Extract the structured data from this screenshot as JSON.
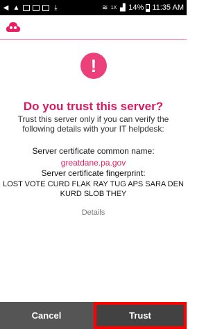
{
  "status_bar": {
    "signal_label": "1X",
    "battery": "14%",
    "time": "11:35 AM"
  },
  "dialog": {
    "warning_symbol": "!",
    "title": "Do you trust this server?",
    "description": "Trust this server only if you can verify the following details with your IT helpdesk:",
    "common_name_label": "Server certificate common name:",
    "common_name_value": "greatdane.pa.gov",
    "fingerprint_label": "Server certificate fingerprint:",
    "fingerprint_value": "LOST VOTE CURD FLAK RAY TUG APS SARA DEN KURD SLOB THEY",
    "details_link": "Details"
  },
  "actions": {
    "cancel_label": "Cancel",
    "trust_label": "Trust"
  },
  "colors": {
    "accent": "#e91e63",
    "title": "#d81b60",
    "highlight_border": "#ff0000"
  }
}
